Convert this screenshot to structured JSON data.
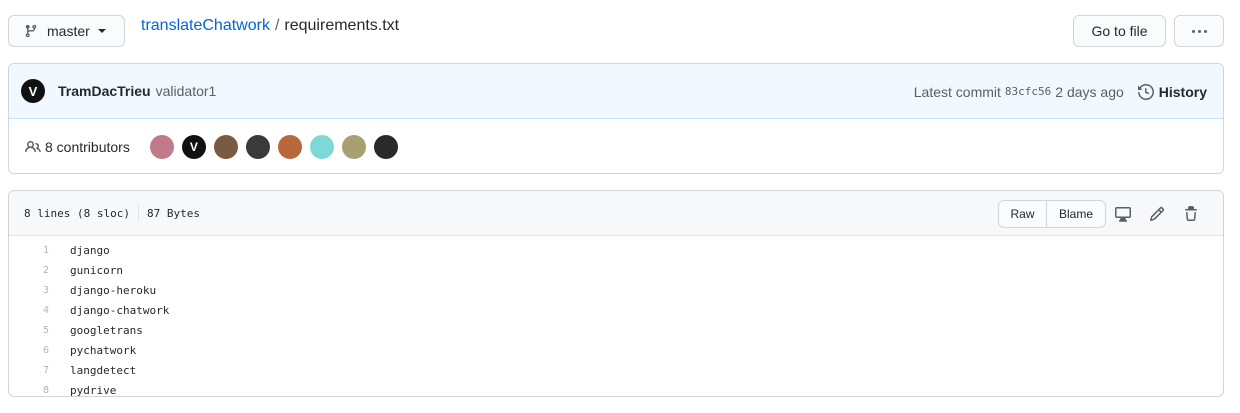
{
  "branch": {
    "label": "master",
    "icon": "git-branch-icon"
  },
  "breadcrumb": {
    "repo": "translateChatwork",
    "separator": "/",
    "file": "requirements.txt"
  },
  "toolbar": {
    "goto_file": "Go to file",
    "more_icon": "kebab-horizontal-icon"
  },
  "commit": {
    "author": "TramDacTrieu",
    "message": "validator1",
    "latest_label": "Latest commit",
    "sha": "83cfc56",
    "time": "2 days ago",
    "history_label": "History"
  },
  "contributors": {
    "label": "8 contributors",
    "avatars": [
      {
        "color": "#c07a8a"
      },
      {
        "color": "#111111"
      },
      {
        "color": "#7a5a40"
      },
      {
        "color": "#3a3a3a"
      },
      {
        "color": "#b8683a"
      },
      {
        "color": "#7fd8d8"
      },
      {
        "color": "#a8a070"
      },
      {
        "color": "#2a2a2a"
      }
    ]
  },
  "file": {
    "lines_info": "8 lines (8 sloc)",
    "size": "87 Bytes",
    "raw_label": "Raw",
    "blame_label": "Blame",
    "lines": [
      {
        "num": "1",
        "text": "django"
      },
      {
        "num": "2",
        "text": "gunicorn"
      },
      {
        "num": "3",
        "text": "django-heroku"
      },
      {
        "num": "4",
        "text": "django-chatwork"
      },
      {
        "num": "5",
        "text": "googletrans"
      },
      {
        "num": "6",
        "text": "pychatwork"
      },
      {
        "num": "7",
        "text": "langdetect"
      },
      {
        "num": "8",
        "text": "pydrive"
      }
    ]
  }
}
